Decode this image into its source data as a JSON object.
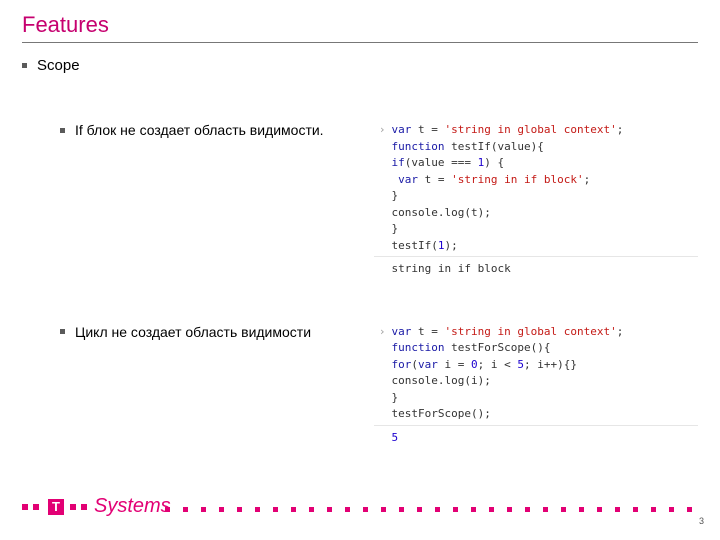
{
  "title": "Features",
  "bullets": {
    "scope": "Scope",
    "ifBlock": "If блок не создает область видимости.",
    "loopBlock": "Цикл не создает область видимости"
  },
  "code1": {
    "lines": [
      [
        {
          "t": "var",
          "c": "kw"
        },
        {
          "t": " t = "
        },
        {
          "t": "'string in global context'",
          "c": "str"
        },
        {
          "t": ";"
        }
      ],
      [
        {
          "t": "function",
          "c": "kw"
        },
        {
          "t": " testIf(value){"
        }
      ],
      [
        {
          "t": "if",
          "c": "kw"
        },
        {
          "t": "(value === "
        },
        {
          "t": "1",
          "c": "num"
        },
        {
          "t": ") {"
        }
      ],
      [
        {
          "t": " "
        },
        {
          "t": "var",
          "c": "kw"
        },
        {
          "t": " t = "
        },
        {
          "t": "'string in if block'",
          "c": "str"
        },
        {
          "t": ";"
        }
      ],
      [
        {
          "t": "}"
        }
      ],
      [
        {
          "t": "console.log(t);"
        }
      ],
      [
        {
          "t": "}"
        }
      ],
      [
        {
          "t": "testIf("
        },
        {
          "t": "1",
          "c": "num"
        },
        {
          "t": ");"
        }
      ]
    ],
    "output": "string in if block"
  },
  "code2": {
    "lines": [
      [
        {
          "t": "var",
          "c": "kw"
        },
        {
          "t": " t = "
        },
        {
          "t": "'string in global context'",
          "c": "str"
        },
        {
          "t": ";"
        }
      ],
      [
        {
          "t": "function",
          "c": "kw"
        },
        {
          "t": " testForScope(){"
        }
      ],
      [
        {
          "t": "for",
          "c": "kw"
        },
        {
          "t": "("
        },
        {
          "t": "var",
          "c": "kw"
        },
        {
          "t": " i = "
        },
        {
          "t": "0",
          "c": "num"
        },
        {
          "t": "; i < "
        },
        {
          "t": "5",
          "c": "num"
        },
        {
          "t": "; i++){}"
        }
      ],
      [
        {
          "t": "console.log(i);"
        }
      ],
      [
        {
          "t": "}"
        }
      ],
      [
        {
          "t": "testForScope();"
        }
      ]
    ],
    "output": "5",
    "outputIsNumber": true
  },
  "logoText": "Systems",
  "pageNumber": "3",
  "chevron": "›"
}
